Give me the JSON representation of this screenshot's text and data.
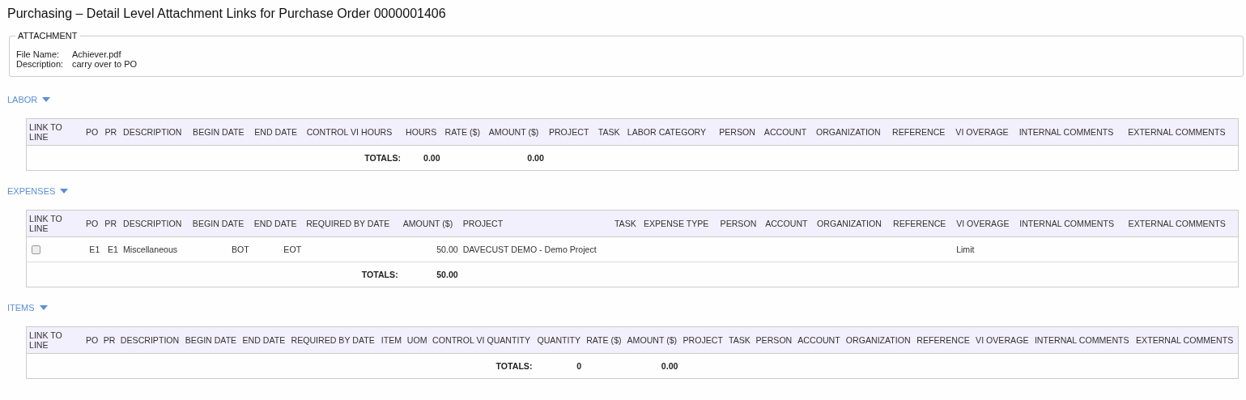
{
  "page_title": "Purchasing – Detail Level Attachment Links for Purchase Order 0000001406",
  "attachment": {
    "legend": "ATTACHMENT",
    "fields": [
      {
        "label": "File Name:",
        "value": "Achiever.pdf"
      },
      {
        "label": "Description:",
        "value": "carry over to PO"
      }
    ]
  },
  "sections": [
    {
      "title": "LABOR",
      "expanded": true,
      "totals_label": "TOTALS:",
      "columns": [
        {
          "label": "LINK TO LINE",
          "kind": "check"
        },
        {
          "label": "PO",
          "kind": "number"
        },
        {
          "label": "PR",
          "kind": "number"
        },
        {
          "label": "DESCRIPTION",
          "kind": "text"
        },
        {
          "label": "BEGIN DATE",
          "kind": "date"
        },
        {
          "label": "END DATE",
          "kind": "date"
        },
        {
          "label": "CONTROL VI HOURS",
          "kind": "number"
        },
        {
          "label": "HOURS",
          "kind": "number",
          "total": "0.00"
        },
        {
          "label": "RATE ($)",
          "kind": "number"
        },
        {
          "label": "AMOUNT ($)",
          "kind": "number",
          "total": "0.00"
        },
        {
          "label": "PROJECT",
          "kind": "text"
        },
        {
          "label": "TASK",
          "kind": "text"
        },
        {
          "label": "LABOR CATEGORY",
          "kind": "text"
        },
        {
          "label": "PERSON",
          "kind": "text"
        },
        {
          "label": "ACCOUNT",
          "kind": "text"
        },
        {
          "label": "ORGANIZATION",
          "kind": "text"
        },
        {
          "label": "REFERENCE",
          "kind": "text"
        },
        {
          "label": "VI OVERAGE",
          "kind": "text"
        },
        {
          "label": "INTERNAL COMMENTS",
          "kind": "text"
        },
        {
          "label": "EXTERNAL COMMENTS",
          "kind": "text"
        }
      ]
    },
    {
      "title": "EXPENSES",
      "expanded": true,
      "totals_label": "TOTALS:",
      "columns": [
        {
          "label": "LINK TO LINE",
          "kind": "check"
        },
        {
          "label": "PO",
          "kind": "number"
        },
        {
          "label": "PR",
          "kind": "number"
        },
        {
          "label": "DESCRIPTION",
          "kind": "text"
        },
        {
          "label": "BEGIN DATE",
          "kind": "date"
        },
        {
          "label": "END DATE",
          "kind": "date"
        },
        {
          "label": "REQUIRED BY DATE",
          "kind": "date"
        },
        {
          "label": "AMOUNT ($)",
          "kind": "number",
          "total": "50.00"
        },
        {
          "label": "PROJECT",
          "kind": "text"
        },
        {
          "label": "TASK",
          "kind": "text"
        },
        {
          "label": "EXPENSE TYPE",
          "kind": "text"
        },
        {
          "label": "PERSON",
          "kind": "text"
        },
        {
          "label": "ACCOUNT",
          "kind": "text"
        },
        {
          "label": "ORGANIZATION",
          "kind": "text"
        },
        {
          "label": "REFERENCE",
          "kind": "text"
        },
        {
          "label": "VI OVERAGE",
          "kind": "text"
        },
        {
          "label": "INTERNAL COMMENTS",
          "kind": "text"
        },
        {
          "label": "EXTERNAL COMMENTS",
          "kind": "text"
        }
      ],
      "rows": [
        {
          "checked": false,
          "cells": [
            null,
            "E1",
            "E1",
            "Miscellaneous",
            "BOT",
            "EOT",
            null,
            "50.00",
            "DAVECUST DEMO - Demo Project",
            null,
            null,
            null,
            null,
            null,
            null,
            "Limit",
            null,
            null
          ]
        }
      ]
    },
    {
      "title": "ITEMS",
      "expanded": true,
      "totals_label": "TOTALS:",
      "columns": [
        {
          "label": "LINK TO LINE",
          "kind": "check"
        },
        {
          "label": "PO",
          "kind": "number"
        },
        {
          "label": "PR",
          "kind": "number"
        },
        {
          "label": "DESCRIPTION",
          "kind": "text"
        },
        {
          "label": "BEGIN DATE",
          "kind": "text"
        },
        {
          "label": "END DATE",
          "kind": "text"
        },
        {
          "label": "REQUIRED BY DATE",
          "kind": "text"
        },
        {
          "label": "ITEM",
          "kind": "text"
        },
        {
          "label": "UOM",
          "kind": "text"
        },
        {
          "label": "CONTROL VI QUANTITY",
          "kind": "text"
        },
        {
          "label": "QUANTITY",
          "kind": "number",
          "total": "0"
        },
        {
          "label": "RATE ($)",
          "kind": "number"
        },
        {
          "label": "AMOUNT ($)",
          "kind": "number",
          "total": "0.00"
        },
        {
          "label": "PROJECT",
          "kind": "text"
        },
        {
          "label": "TASK",
          "kind": "text"
        },
        {
          "label": "PERSON",
          "kind": "text"
        },
        {
          "label": "ACCOUNT",
          "kind": "text"
        },
        {
          "label": "ORGANIZATION",
          "kind": "text"
        },
        {
          "label": "REFERENCE",
          "kind": "text"
        },
        {
          "label": "VI OVERAGE",
          "kind": "text"
        },
        {
          "label": "INTERNAL COMMENTS",
          "kind": "text"
        },
        {
          "label": "EXTERNAL COMMENTS",
          "kind": "text"
        }
      ]
    }
  ]
}
